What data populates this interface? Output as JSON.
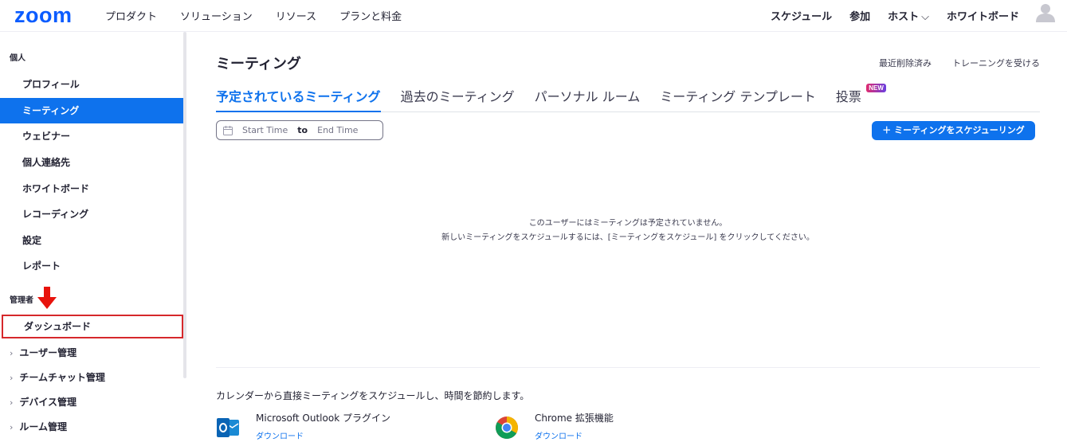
{
  "brand": {
    "logo": "zoom",
    "color": "#0b5cff"
  },
  "topnav": {
    "left": [
      "プロダクト",
      "ソリューション",
      "リソース",
      "プランと料金"
    ],
    "schedule": "スケジュール",
    "join": "参加",
    "host": "ホスト",
    "whiteboard": "ホワイトボード"
  },
  "sidebar": {
    "personal_label": "個人",
    "items": [
      "プロフィール",
      "ミーティング",
      "ウェビナー",
      "個人連絡先",
      "ホワイトボード",
      "レコーディング",
      "設定",
      "レポート"
    ],
    "active_index": 1,
    "admin_label": "管理者",
    "admin_item": "ダッシュボード",
    "expandable": [
      "ユーザー管理",
      "チームチャット管理",
      "デバイス管理",
      "ルーム管理"
    ]
  },
  "main": {
    "title": "ミーティング",
    "links": [
      "最近削除済み",
      "トレーニングを受ける"
    ],
    "tabs": [
      "予定されているミーティング",
      "過去のミーティング",
      "パーソナル ルーム",
      "ミーティング テンプレート",
      "投票"
    ],
    "new_badge": "NEW",
    "date_start_placeholder": "Start Time",
    "date_to": "to",
    "date_end_placeholder": "End Time",
    "schedule_button": "＋ ミーティングをスケジューリング",
    "empty_line1": "このユーザーにはミーティングは予定されていません。",
    "empty_line2": "新しいミーティングをスケジュールするには、[ミーティングをスケジュール] をクリックしてください。",
    "calendar_promo": "カレンダーから直接ミーティングをスケジュールし、時間を節約します。",
    "plugins": [
      {
        "icon": "outlook-icon",
        "title": "Microsoft Outlook プラグイン",
        "link": "ダウンロード"
      },
      {
        "icon": "chrome-icon",
        "title": "Chrome 拡張機能",
        "link": "ダウンロード"
      }
    ]
  }
}
